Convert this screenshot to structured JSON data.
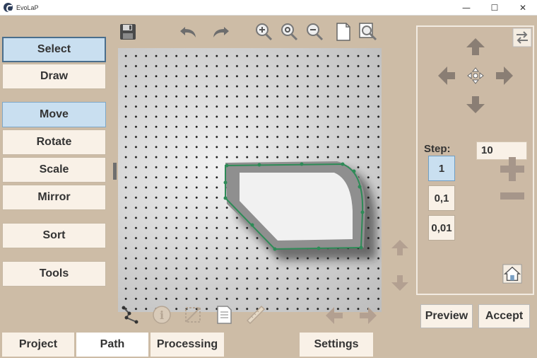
{
  "window": {
    "title": "EvoLaP",
    "minimize": "—",
    "maximize": "☐",
    "close": "✕"
  },
  "mode_buttons": [
    "Select",
    "Draw"
  ],
  "transform_buttons": [
    "Move",
    "Rotate",
    "Scale",
    "Mirror"
  ],
  "sort_label": "Sort",
  "tools_label": "Tools",
  "toolbar_icons": [
    "save-icon",
    "undo-icon",
    "redo-icon",
    "zoom-in-icon",
    "zoom-reset-icon",
    "zoom-out-icon",
    "page-icon",
    "zoom-fit-icon"
  ],
  "path_tools": [
    "path-nodes-icon",
    "info-icon",
    "crop-icon",
    "document-icon",
    "ruler-icon"
  ],
  "right_panel": {
    "step_label": "Step:",
    "step_value": "10",
    "step_options": [
      "1",
      "0,1",
      "0,01"
    ],
    "selected_step": "1"
  },
  "actions": {
    "preview": "Preview",
    "accept": "Accept"
  },
  "tabs": [
    "Project",
    "Path",
    "Processing",
    "Settings"
  ],
  "active_tab": "Path",
  "colors": {
    "background": "#cdbca6",
    "button": "#f9f1e7",
    "active": "#c9dff0",
    "path": "#2e8b57"
  }
}
